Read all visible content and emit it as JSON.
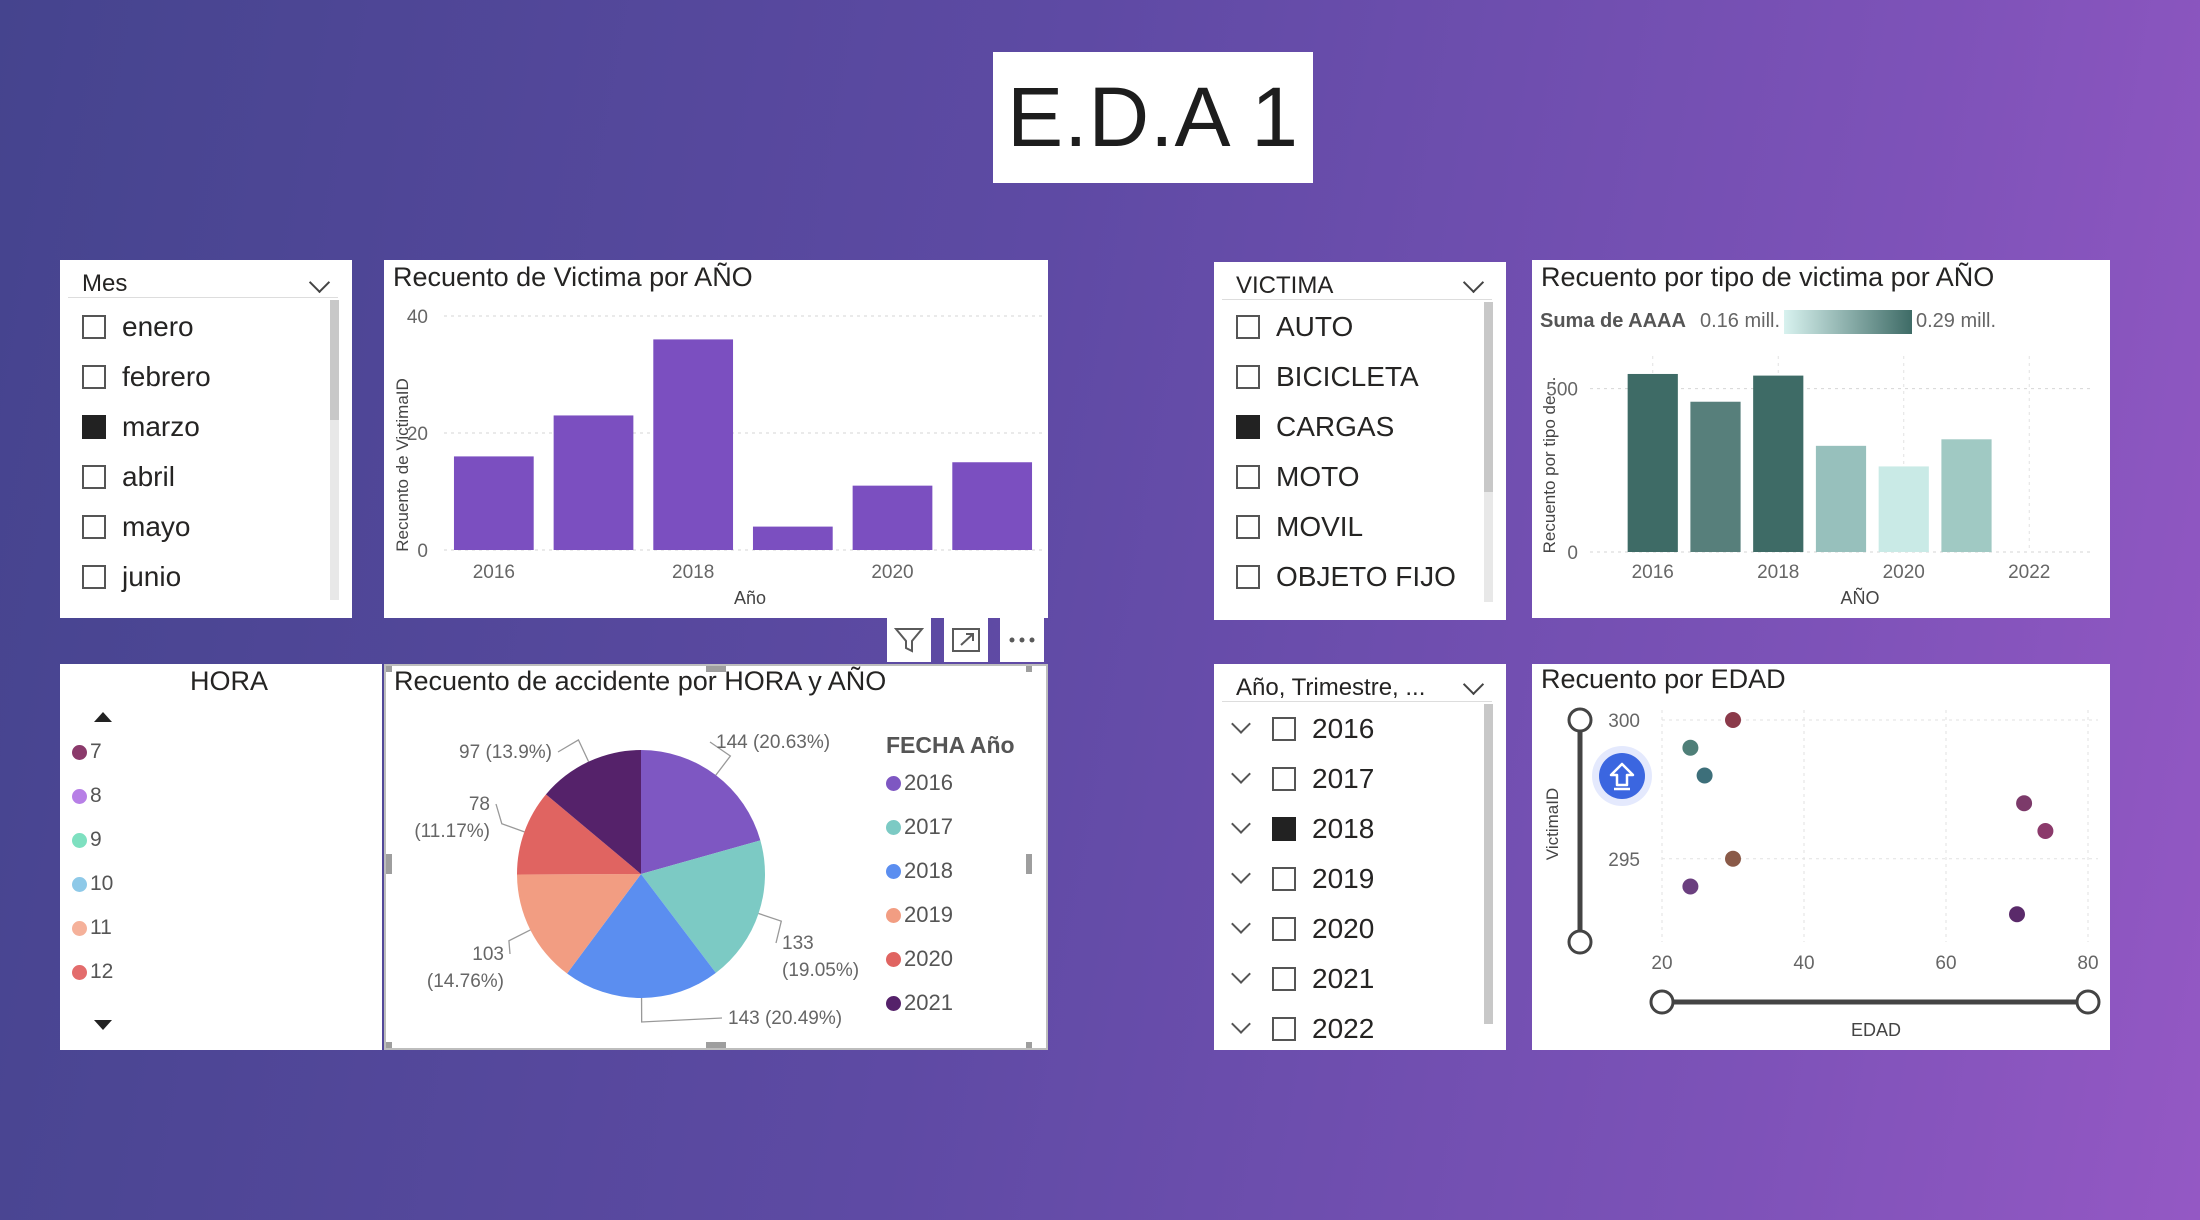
{
  "page_title": "E.D.A 1",
  "mes_slicer": {
    "header": "Mes",
    "items": [
      {
        "label": "enero",
        "checked": false
      },
      {
        "label": "febrero",
        "checked": false
      },
      {
        "label": "marzo",
        "checked": true
      },
      {
        "label": "abril",
        "checked": false
      },
      {
        "label": "mayo",
        "checked": false
      },
      {
        "label": "junio",
        "checked": false
      }
    ]
  },
  "victima_slicer": {
    "header": "VICTIMA",
    "items": [
      {
        "label": "AUTO",
        "checked": false
      },
      {
        "label": "BICICLETA",
        "checked": false
      },
      {
        "label": "CARGAS",
        "checked": true
      },
      {
        "label": "MOTO",
        "checked": false
      },
      {
        "label": "MOVIL",
        "checked": false
      },
      {
        "label": "OBJETO FIJO",
        "checked": false
      }
    ]
  },
  "anio_slicer": {
    "header": "Año, Trimestre, ...",
    "items": [
      {
        "label": "2016",
        "checked": false
      },
      {
        "label": "2017",
        "checked": false
      },
      {
        "label": "2018",
        "checked": true
      },
      {
        "label": "2019",
        "checked": false
      },
      {
        "label": "2020",
        "checked": false
      },
      {
        "label": "2021",
        "checked": false
      },
      {
        "label": "2022",
        "checked": false
      }
    ]
  },
  "hora_legend": {
    "title": "HORA",
    "items": [
      {
        "label": "7",
        "color": "#8b3a6b"
      },
      {
        "label": "8",
        "color": "#b77fe6"
      },
      {
        "label": "9",
        "color": "#7ee0c0"
      },
      {
        "label": "10",
        "color": "#8ec9e8"
      },
      {
        "label": "11",
        "color": "#f5b19a"
      },
      {
        "label": "12",
        "color": "#e36c6c"
      }
    ]
  },
  "visual_toolbar": {
    "filter_icon": "filter-icon",
    "focus_icon": "focus-mode-icon",
    "more_icon": "more-options-icon"
  },
  "charts": {
    "victima_por_anio": {
      "title": "Recuento de Victima por AÑO",
      "xlabel": "Año",
      "ylabel": "Recuento de VictimaID",
      "yticks": [
        "0",
        "20",
        "40"
      ],
      "xticks": [
        "2016",
        "2018",
        "2020"
      ],
      "color": "#7b4fc0"
    },
    "tipo_victima": {
      "title": "Recuento por tipo de victima por AÑO",
      "legend_label": "Suma de AAAA",
      "legend_min": "0.16 mill.",
      "legend_max": "0.29 mill.",
      "xlabel": "AÑO",
      "ylabel": "Recuento por tipo de ...",
      "yticks": [
        "0",
        "500"
      ],
      "xticks": [
        "2016",
        "2018",
        "2020",
        "2022"
      ]
    },
    "accidente_pie": {
      "title": "Recuento de accidente por HORA y AÑO",
      "legend_title": "FECHA Año",
      "slice_labels": [
        [
          "144 (20.63%)"
        ],
        [
          "133",
          "(19.05%)"
        ],
        [
          "143 (20.49%)"
        ],
        [
          "103",
          "(14.76%)"
        ],
        [
          "78",
          "(11.17%)"
        ],
        [
          "97 (13.9%)"
        ]
      ]
    },
    "edad_scatter": {
      "title": "Recuento por EDAD",
      "xlabel": "EDAD",
      "ylabel": "VictimaID",
      "xticks": [
        "20",
        "40",
        "60",
        "80"
      ],
      "yticks": [
        "295",
        "300"
      ]
    }
  },
  "chart_data": [
    {
      "type": "bar",
      "title": "Recuento de Victima por AÑO",
      "xlabel": "Año",
      "ylabel": "Recuento de VictimaID",
      "categories": [
        "2016",
        "2017",
        "2018",
        "2019",
        "2020",
        "2021"
      ],
      "values": [
        16,
        23,
        36,
        4,
        11,
        15
      ],
      "ylim": [
        0,
        40
      ],
      "grid": true
    },
    {
      "type": "bar",
      "title": "Recuento por tipo de victima por AÑO",
      "xlabel": "AÑO",
      "ylabel": "Recuento por tipo de ...",
      "categories": [
        "2016",
        "2017",
        "2018",
        "2019",
        "2020",
        "2021"
      ],
      "values": [
        545,
        460,
        540,
        325,
        262,
        345
      ],
      "colors": [
        "#3e6b66",
        "#577f7b",
        "#3e6b66",
        "#97c0bc",
        "#c9eae6",
        "#a0c9c3"
      ],
      "ylim": [
        0,
        600
      ],
      "xlim": [
        2015,
        2023
      ],
      "grid": true
    },
    {
      "type": "pie",
      "title": "Recuento de accidente por HORA y AÑO",
      "legend_title": "FECHA Año",
      "legend_position": "right",
      "slices": [
        {
          "label": "2016",
          "value": 144,
          "percent": 20.63,
          "color": "#7e57c2"
        },
        {
          "label": "2017",
          "value": 133,
          "percent": 19.05,
          "color": "#7ccac4"
        },
        {
          "label": "2018",
          "value": 143,
          "percent": 20.49,
          "color": "#5b8ef0"
        },
        {
          "label": "2019",
          "value": 103,
          "percent": 14.76,
          "color": "#f29d82"
        },
        {
          "label": "2020",
          "value": 78,
          "percent": 11.17,
          "color": "#e06461"
        },
        {
          "label": "2021",
          "value": 97,
          "percent": 13.9,
          "color": "#55226a"
        }
      ]
    },
    {
      "type": "scatter",
      "title": "Recuento por EDAD",
      "xlabel": "EDAD",
      "ylabel": "VictimaID",
      "xlim": [
        20,
        80
      ],
      "ylim": [
        292,
        300
      ],
      "grid": true,
      "points": [
        {
          "x": 30,
          "y": 300,
          "color": "#8b3a4a"
        },
        {
          "x": 24,
          "y": 299,
          "color": "#4f7f78"
        },
        {
          "x": 26,
          "y": 298,
          "color": "#3d6f7a"
        },
        {
          "x": 30,
          "y": 295,
          "color": "#8a5a48"
        },
        {
          "x": 24,
          "y": 294,
          "color": "#6b3f7f"
        },
        {
          "x": 71,
          "y": 297,
          "color": "#7c3a6a"
        },
        {
          "x": 74,
          "y": 296,
          "color": "#8b3a6b"
        },
        {
          "x": 70,
          "y": 293,
          "color": "#5a2a6a"
        }
      ]
    }
  ]
}
